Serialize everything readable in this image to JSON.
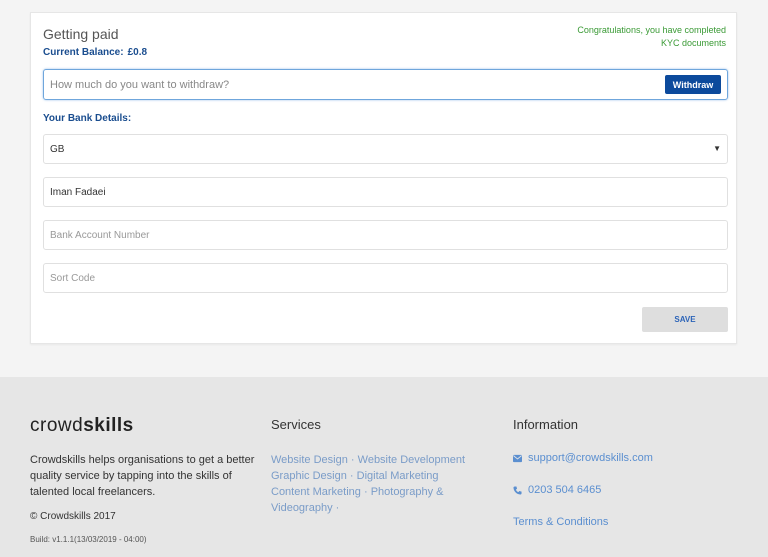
{
  "card": {
    "title": "Getting paid",
    "balance_label": "Current Balance:",
    "balance_value": "£0.8",
    "kyc_message": "Congratulations, you have completed KYC documents",
    "withdraw_placeholder": "How much do you want to withdraw?",
    "withdraw_button": "Withdraw",
    "bank_heading": "Your Bank Details:",
    "country_value": "GB",
    "name_value": "Iman Fadaei",
    "account_placeholder": "Bank Account Number",
    "sort_placeholder": "Sort Code",
    "save_button": "SAVE"
  },
  "footer": {
    "brand_light": "crowd",
    "brand_bold": "skills",
    "about": "Crowdskills helps organisations to get a better quality service by tapping into the skills of talented local freelancers.",
    "copyright": "© Crowdskills 2017",
    "build": "Build: v1.1.1(13/03/2019 - 04:00)",
    "services_title": "Services",
    "services": [
      "Website Design",
      "Website Development",
      "Graphic Design",
      "Digital Marketing",
      "Content Marketing",
      "Photography &",
      "Videography"
    ],
    "information_title": "Information",
    "email": "support@crowdskills.com",
    "phone": "0203 504 6465",
    "terms": "Terms & Conditions"
  },
  "icons": {
    "email": "envelope-icon",
    "phone": "phone-icon",
    "select": "caret-down-icon"
  },
  "colors": {
    "primary": "#0c4a9c",
    "heading_blue": "#1a4d8f",
    "success": "#3a9a35",
    "link": "#5b8fd0"
  }
}
